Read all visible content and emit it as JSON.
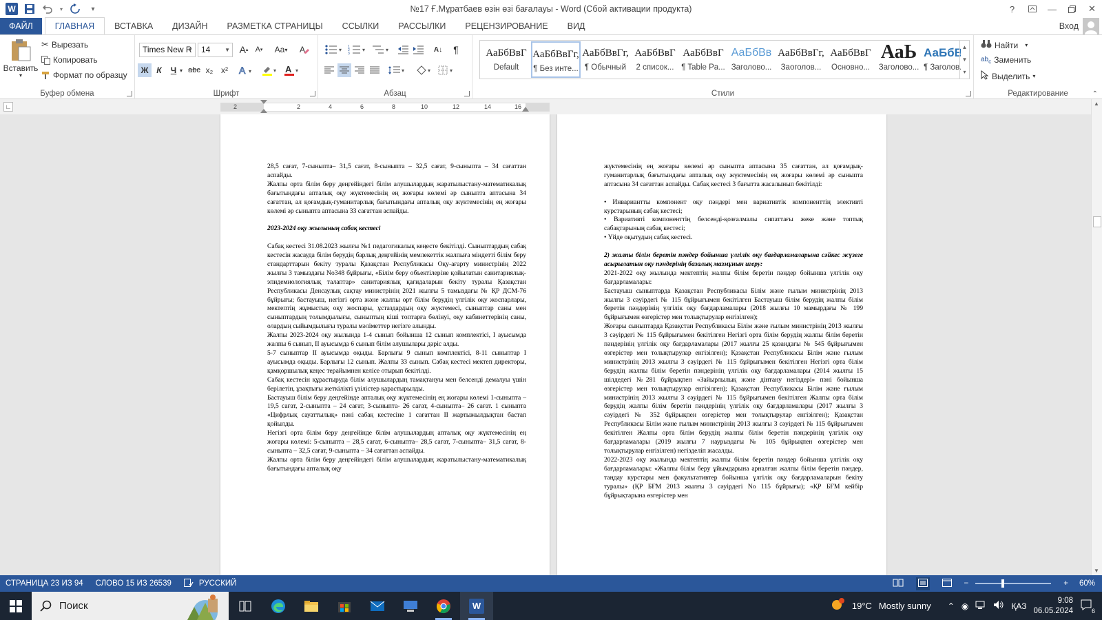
{
  "window": {
    "title": "№17 Ғ.Мұратбаев өзін өзі бағалауы - Word (Сбой активации продукта)",
    "help": "?",
    "signin": "Вход"
  },
  "tabs": [
    "ФАЙЛ",
    "ГЛАВНАЯ",
    "ВСТАВКА",
    "ДИЗАЙН",
    "РАЗМЕТКА СТРАНИЦЫ",
    "ССЫЛКИ",
    "РАССЫЛКИ",
    "РЕЦЕНЗИРОВАНИЕ",
    "ВИД"
  ],
  "ribbon": {
    "clipboard": {
      "label": "Буфер обмена",
      "paste": "Вставить",
      "cut": "Вырезать",
      "copy": "Копировать",
      "format_painter": "Формат по образцу"
    },
    "font": {
      "label": "Шрифт",
      "font_name": "Times New R",
      "font_size": "14",
      "bold": "Ж",
      "italic": "К",
      "underline": "Ч",
      "strike": "abc",
      "sub": "x₂",
      "sup": "x²",
      "grow": "A",
      "shrink": "A",
      "case": "Aa",
      "font_color_hex": "#e0201e",
      "highlight_hex": "#ffff00"
    },
    "paragraph": {
      "label": "Абзац"
    },
    "styles": {
      "label": "Стили",
      "items": [
        {
          "sample": "АаБбВвГ",
          "name": "Default"
        },
        {
          "sample": "АаБбВвГг,",
          "name": "¶ Без инте..."
        },
        {
          "sample": "АаБбВвГг,",
          "name": "¶ Обычный"
        },
        {
          "sample": "АаБбВвГ",
          "name": "2 список..."
        },
        {
          "sample": "АаБбВвГ",
          "name": "¶ Table Pa..."
        },
        {
          "sample": "АаБбВв",
          "name": "Заголово..."
        },
        {
          "sample": "АаБбВвГг,",
          "name": "Заоголов..."
        },
        {
          "sample": "АаБбВвГ",
          "name": "Основно..."
        },
        {
          "sample": "АаЬ",
          "name": "Заголово..."
        },
        {
          "sample": "АаБбВ:",
          "name": "¶ Заголов..."
        }
      ]
    },
    "editing": {
      "label": "Редактирование",
      "find": "Найти",
      "replace": "Заменить",
      "select": "Выделить"
    }
  },
  "ruler": {
    "ticks": [
      "2",
      "2",
      "4",
      "6",
      "8",
      "10",
      "12",
      "14",
      "16"
    ]
  },
  "doc": {
    "left_page": [
      {
        "t": "28,5 сағат, 7-сыныпта– 31,5 сағат, 8-сыныпта – 32,5 сағат, 9-сыныпта – 34 сағаттан аспайды."
      },
      {
        "t": "Жалпы орта білім беру деңгейіндегі білім алушылардың жаратылыстану-математикалық бағытындағы апталық оқу жүктемесінің ең жоғары көлемі әр сыныпта аптасына 34 сағаттан, ал қоғамдық-гуманитарлық бағытындағы апталық оқу жүктемесінің ең жоғары көлемі әр сыныпта аптасына 33 сағаттан аспайды."
      },
      {
        "gap": true
      },
      {
        "t": "2023-2024 оқу жылының сабақ кестесі",
        "bi": true
      },
      {
        "gap": true
      },
      {
        "t": "Сабақ кестесі 31.08.2023 жылғы №1 педагогикалық кеңесте бекітілді. Сыныптардың сабақ кестесін жасауда білім берудің барлық деңгейінің мемлекеттік жалпыға міндетті білім беру стандарттарын бекіту туралы Қазақстан Республикасы Оқу-ағарту министрінің 2022 жылғы 3 тамыздағы No348 бұйрығы, «Білім беру объектілеріне қойылатын санитариялық-эпидемиологиялық талаптар» санитариялық қағидаларын бекіту туралы Қазақстан Республикасы Денсаулық сақтау министрінің 2021 жылғы 5 тамыздағы № ҚР ДСМ-76 бұйрығы; бастауыш, негізгі орта және жалпы орт білім берудің үлгілік оқу жоспарлары, мектептің жұмыстық оқу жоспары, ұстаздардың оқу жүктемесі, сыныптар саны мен сыныптардың толымдылығы, сыныптың кіші топтарға бөлінуі, оқу кабинеттерінің саны, олардың сыйымдылығы туралы мәліметтер негізге алынды."
      },
      {
        "t": "Жалпы 2023-2024 оқу жылында 1-4 сынып бойынша 12 сынып комплектісі, I ауысымда жалпы 6 сынып, II ауысымда 6 сынып білім алушылары дәріс алды."
      },
      {
        "t": "5-7 сыныптар II ауысымда оқыды. Барлығы 9 сынып комплектісі, 8-11 сыныптар I ауысымда оқыды. Барлығы 12 сынып. Жалпы 33 сынып. Сабақ кестесі мектеп директоры, қамқоршылық кеңес терайымнен келісе отырып бекітілді."
      },
      {
        "t": "Сабақ кестесін құрастыруда білім алушылардың тамақтануы мен белсенді демалуы үшін берілетін, ұзақтығы жеткілікті үзілістер қарастырылды."
      },
      {
        "t": "Бастауыш білім беру деңгейінде апталық оқу жүктемесінің ең жоғары көлемі 1-сыныпта – 19,5 сағат, 2-сыныпта – 24 сағат, 3-сыныпта- 26 сағат, 4-сыныпта– 26 сағат. 1 сыныпта «Цифрлық сауаттылық» пәні сабақ кестесіне 1 сағаттан II жартыжылдықтан бастап қойылды."
      },
      {
        "t": "Негізгі орта білім беру деңгейінде білім алушылардың апталық оқу жүктемесінің ең жоғары көлемі: 5-сыныпта – 28,5 сағат, 6-сыныпта– 28,5 сағат, 7-сыныпта– 31,5 сағат, 8-сыныпта – 32,5 сағат, 9-сыныпта – 34 сағаттан аспайды."
      },
      {
        "t": "Жалпы орта білім беру деңгейіндегі білім алушылардың жаратылыстану-математикалық бағытындағы апталық оқу"
      }
    ],
    "right_page": [
      {
        "t": "жүктемесінің ең жоғары көлемі әр сыныпта аптасына 35 сағаттан, ал қоғамдық-гуманитарлық бағытындағы апталық оқу жүктемесінің ең жоғары көлемі әр сыныпта аптасына 34 сағаттан аспайды. Сабақ кестесі 3 бағытта жасалынып бекітілді:"
      },
      {
        "gap": true
      },
      {
        "t": "•         Инвариантты компонент оқу пәндері мен вариативтік компоненттің элективті курстарының сабақ кестесі;"
      },
      {
        "t": "•         Вариативті компоненттің белсенді-қозғалмалы сипаттағы жеке және топтық сабақтарының сабақ кестесі;"
      },
      {
        "t": "• Үйде оқытудың сабақ кестесі."
      },
      {
        "gap": true
      },
      {
        "t": "2) жалпы білім беретін пәндер бойынша үлгілік оқу бағдарламаларына сәйкес жүзеге асырылатын оқу пәндерінің базалық мазмұнын игеру:",
        "bi": true
      },
      {
        "t": "2021-2022 оқу жылында мектептің жалпы білім беретін пәндер бойынша үлгілік оқу бағдарламалары:"
      },
      {
        "t": "Бастауыш сыныптарда Қазақстан Республикасы Білім және ғылым министрінің 2013 жылғы 3 сәуірдегі № 115 бұйрығымен бекітілген Бастауыш білім берудің жалпы білім беретін пәндерінің үлгілік оқу бағдарламалары (2018 жылғы 10 мамырдағы № 199 бұйрығымен өзгерістер мен толықтырулар енгізілген);"
      },
      {
        "t": "Жоғары сыныптарда Қазақстан Республикасы Білім және ғылым министрінің 2013 жылғы 3 сәуірдегі № 115 бұйрығымен бекітілген Негізгі орта білім берудің жалпы білім беретін пәндерінің үлгілік оқу бағдарламалары (2017 жылғы 25 қазандағы № 545 бұйрығымен өзгерістер мен толықтырулар енгізілген); Қазақстан Республикасы Білім және ғылым министрінің 2013 жылғы 3 сәуірдегі № 115 бұйрығымен бекітілген Негізгі орта білім берудің жалпы білім беретін пәндерінің үлгілік оқу бағдарламалары (2014 жылғы 15 шілдедегі №281 бұйрықпен «Зайырлылық және дінтану негіздері» пәні бойынша өзгерістер мен толықтырулар енгізілген); Қазақстан Республикасы Білім және ғылым министрінің 2013 жылғы 3 сәуірдегі № 115 бұйрығымен бекітілген Жалпы орта білім берудің жалпы білім беретін пәндерінің үлгілік оқу бағдарламалары (2017 жылғы 3 сәуірдегі № 352 бұйрықпен өзгерістер мен толықтырулар енгізілген); Қазақстан Республикасы Білім және ғылым министрінің 2013 жылғы 3 сәуірдегі № 115 бұйрығымен бекітілген Жалпы орта білім берудің жалпы білім беретін пәндерінің үлгілік оқу бағдарламалары (2019 жылғы 7 наурыздағы № 105 бұйрықпен өзгерістер мен толықтырулар енгізілген) негізделіп жасалды."
      },
      {
        "t": "2022-2023 оқу жылында мектептің жалпы білім беретін пәндер бойынша үлгілік оқу бағдарламалары: «Жалпы білім беру ұйымдарына арналған жалпы білім беретін пәндер, таңдау курстары мен факультативтер бойынша үлгілік оқу бағдарламаларын бекіту туралы» (ҚР БҒМ 2013 жылғы 3 сәуірдегі No 115 бұйрығы); «ҚР БҒМ кейбір бұйрықтарына өзгерістер мен"
      }
    ]
  },
  "status": {
    "page": "СТРАНИЦА 23 ИЗ 94",
    "words": "СЛОВО 15 ИЗ 26539",
    "language": "РУССКИЙ",
    "zoom": "60%"
  },
  "taskbar": {
    "search": "Поиск",
    "weather_temp": "19°C",
    "weather_text": "Mostly sunny",
    "lang": "ҚАЗ",
    "time": "9:08",
    "date": "06.05.2024",
    "notif_count": "6"
  }
}
